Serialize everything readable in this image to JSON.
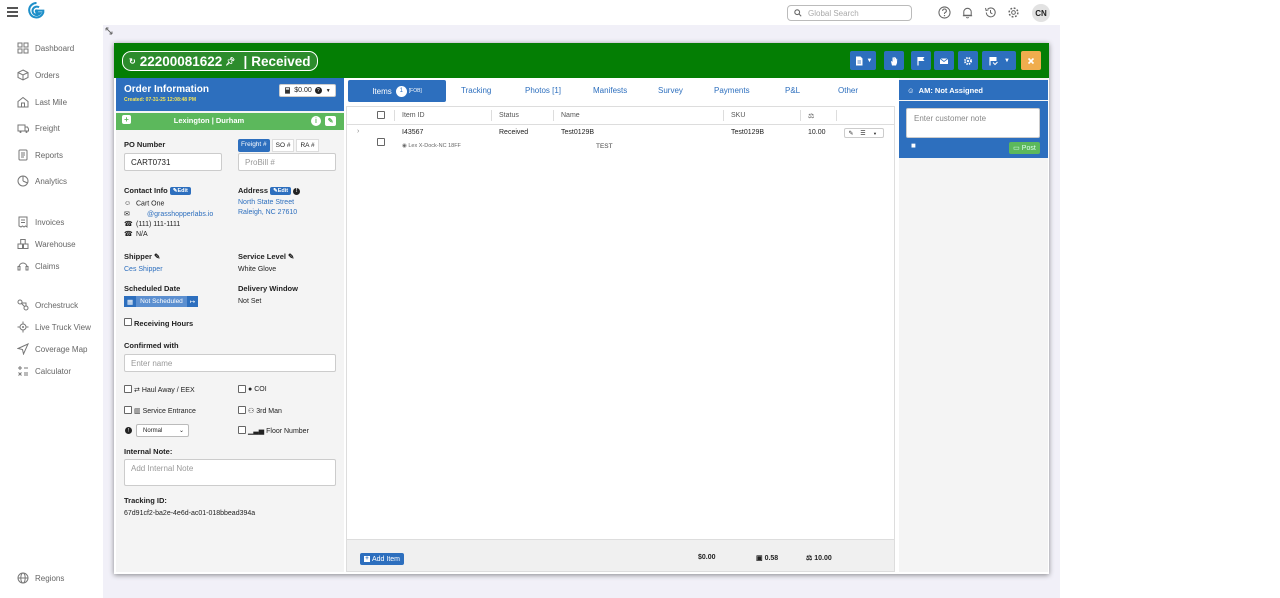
{
  "topbar": {
    "search_placeholder": "Global Search",
    "avatar_initials": "CN",
    "icons": [
      "help-icon",
      "bell-icon",
      "history-icon",
      "gear-icon"
    ]
  },
  "sidebar": {
    "items": [
      {
        "label": "Dashboard",
        "icon": "dashboard-icon"
      },
      {
        "label": "Orders",
        "icon": "orders-icon"
      },
      {
        "label": "Last Mile",
        "icon": "last-mile-icon"
      },
      {
        "label": "Freight",
        "icon": "freight-icon"
      },
      {
        "label": "Reports",
        "icon": "reports-icon"
      },
      {
        "label": "Analytics",
        "icon": "analytics-icon"
      },
      {
        "label": "Invoices",
        "icon": "invoices-icon"
      },
      {
        "label": "Warehouse",
        "icon": "warehouse-icon"
      },
      {
        "label": "Claims",
        "icon": "claims-icon"
      },
      {
        "label": "Orchestruck",
        "icon": "orchestruck-icon"
      },
      {
        "label": "Live Truck View",
        "icon": "live-truck-icon"
      },
      {
        "label": "Coverage Map",
        "icon": "coverage-map-icon"
      },
      {
        "label": "Calculator",
        "icon": "calculator-icon"
      }
    ],
    "regions_label": "Regions"
  },
  "order": {
    "number": "22200081622",
    "status": "Received",
    "header_color": "#047e04",
    "accent_color": "#2d6fbe"
  },
  "order_info": {
    "title": "Order Information",
    "created": "Created: 07-31-25 12:08:48 PM",
    "amount": "$0.00",
    "branch": "Lexington | Durham",
    "po_label": "PO Number",
    "po_value": "CART0731",
    "freight_tabs": [
      "Freight #",
      "SO #",
      "RA #"
    ],
    "probill_placeholder": "ProBill #",
    "contact_label": "Contact Info",
    "edit_label": "Edit",
    "contact_name": "Cart One",
    "contact_email": "@grasshopperlabs.io",
    "contact_phone": "(111) 111-1111",
    "contact_alt": "N/A",
    "address_label": "Address",
    "address_line1": "North State Street",
    "address_line2": "Raleigh, NC 27610",
    "shipper_label": "Shipper",
    "shipper_value": "Ces Shipper",
    "service_level_label": "Service Level",
    "service_level_value": "White Glove",
    "scheduled_label": "Scheduled Date",
    "scheduled_value": "Not Scheduled",
    "delivery_window_label": "Delivery Window",
    "delivery_window_value": "Not Set",
    "receiving_hours": "Receiving Hours",
    "confirmed_label": "Confirmed with",
    "confirmed_placeholder": "Enter name",
    "opt_haul": "Haul Away / EEX",
    "opt_coi": "COI",
    "opt_service_entrance": "Service Entrance",
    "opt_third_man": "3rd Man",
    "priority_value": "Normal",
    "opt_floor": "Floor Number",
    "internal_note_label": "Internal Note:",
    "internal_note_placeholder": "Add Internal Note",
    "tracking_label": "Tracking ID:",
    "tracking_value": "67d91cf2-ba2e-4e6d-ac01-018bbead394a"
  },
  "tabs": {
    "items_label": "Items",
    "items_count": "1",
    "items_tag": "[FOB]",
    "others": [
      "Tracking",
      "Photos [1]",
      "Manifests",
      "Survey",
      "Payments",
      "P&L",
      "Other"
    ]
  },
  "grid": {
    "columns": [
      "Item ID",
      "Status",
      "Name",
      "SKU"
    ],
    "row": {
      "item_id": "I43567",
      "location": "Lex X-Dock-NC 18FF",
      "status": "Received",
      "name": "Test0129B",
      "sub_name": "TEST",
      "sku": "Test0129B",
      "weight": "10.00"
    },
    "add_item_label": "Add Item",
    "total_amount": "$0.00",
    "total_volume": "0.58",
    "total_weight": "10.00"
  },
  "right_panel": {
    "am_label": "AM: Not Assigned",
    "note_placeholder": "Enter customer note",
    "post_label": "Post"
  }
}
